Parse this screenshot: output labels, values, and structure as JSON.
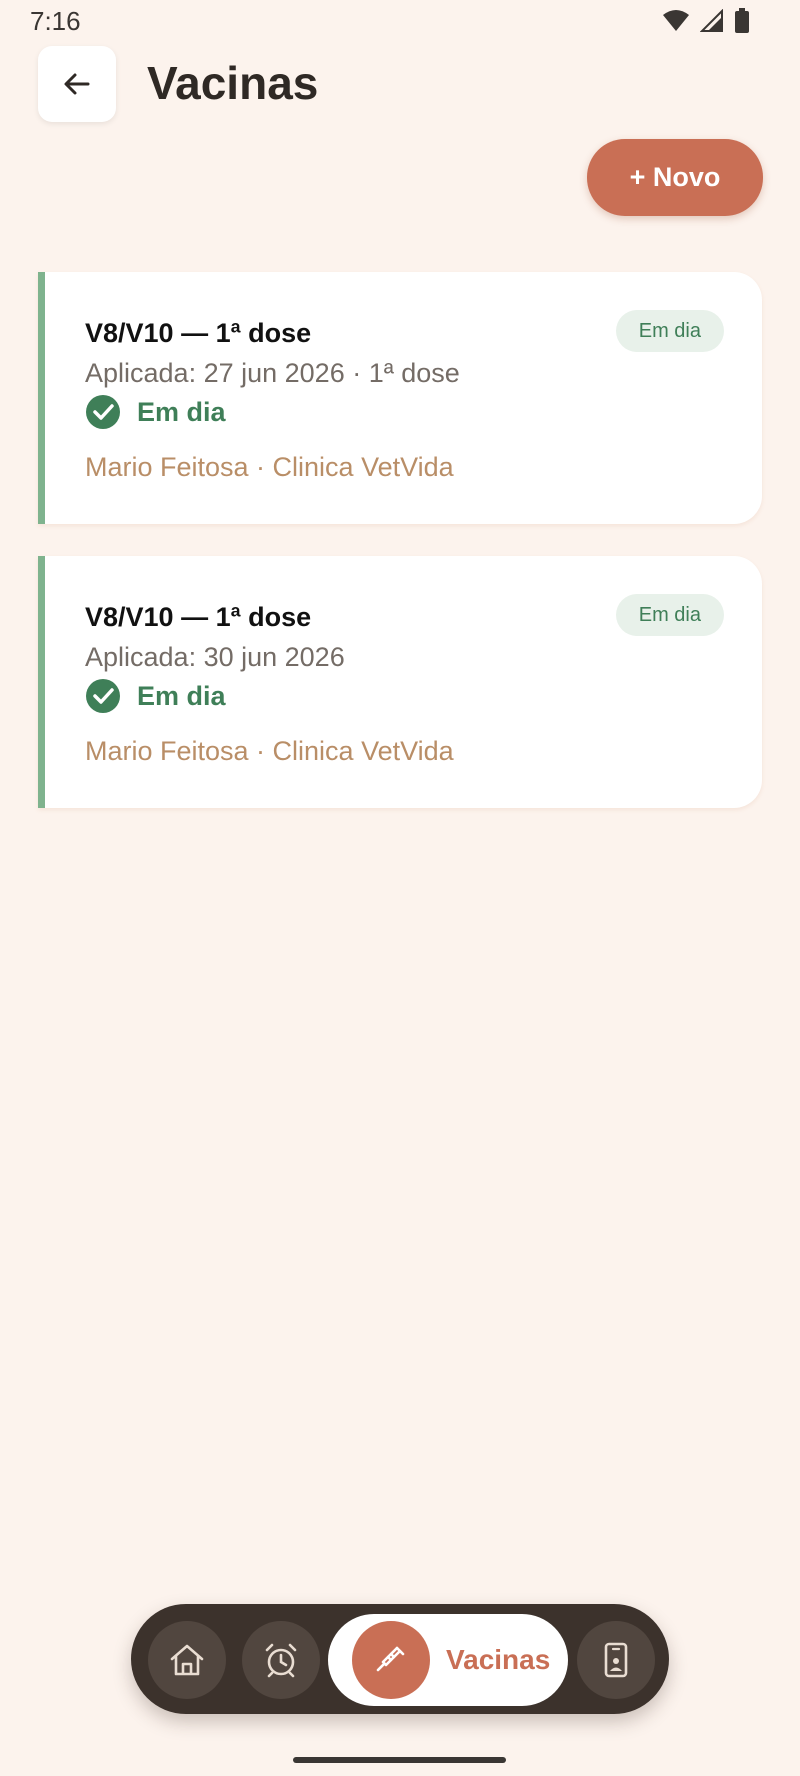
{
  "status_bar": {
    "time": "7:16"
  },
  "header": {
    "title": "Vacinas",
    "new_button": "+ Novo"
  },
  "vaccines": [
    {
      "title": "V8/V10 — 1ª dose",
      "date": "Aplicada: 27 jun 2026 · 1ª dose",
      "status": "Em dia",
      "badge": "Em dia",
      "meta": "Mario Feitosa · Clinica VetVida"
    },
    {
      "title": "V8/V10 — 1ª dose",
      "date": "Aplicada: 30 jun 2026",
      "status": "Em dia",
      "badge": "Em dia",
      "meta": "Mario Feitosa · Clinica VetVida"
    }
  ],
  "bottom_nav": {
    "items": [
      {
        "icon": "home-icon"
      },
      {
        "icon": "alarm-icon"
      },
      {
        "icon": "syringe-icon",
        "label": "Vacinas",
        "active": true
      },
      {
        "icon": "id-card-icon"
      }
    ]
  },
  "colors": {
    "background": "#fcf3ed",
    "accent": "#c96f55",
    "success": "#3f7f58",
    "card_border": "#7fb38e",
    "meta_text": "#b98e67",
    "nav_bg": "#3c322c"
  }
}
